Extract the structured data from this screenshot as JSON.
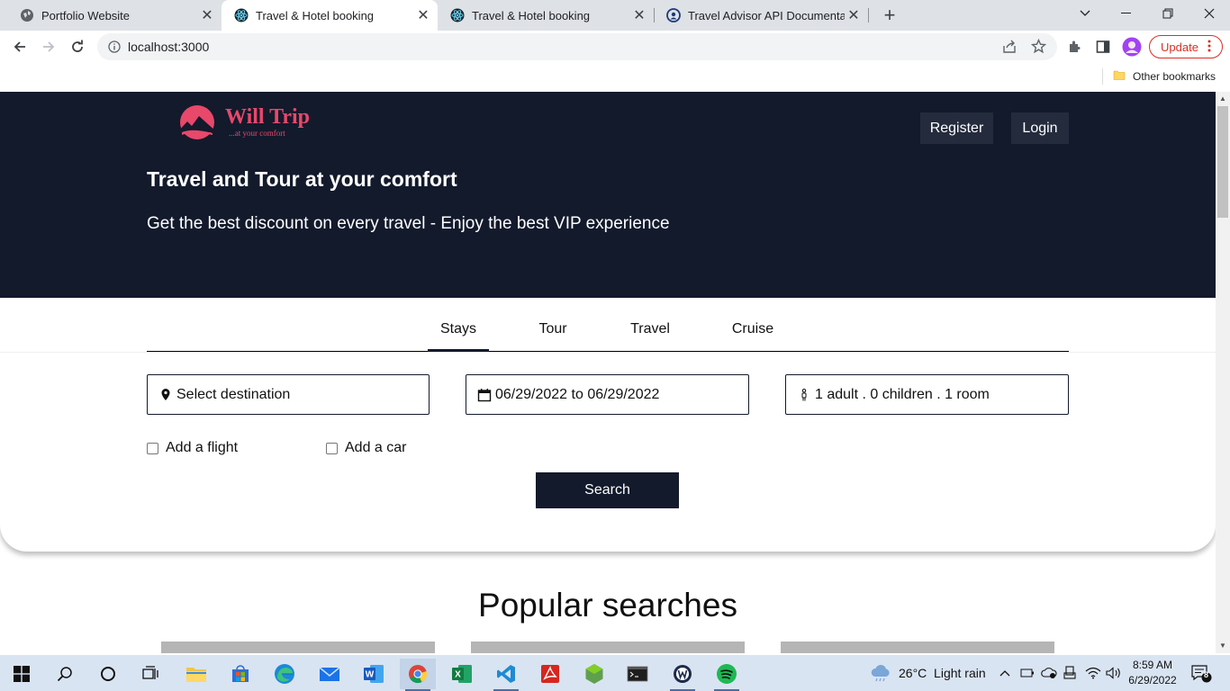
{
  "browser": {
    "tabs": [
      {
        "label": "Portfolio Website",
        "icon": "globe-icon",
        "active": false
      },
      {
        "label": "Travel & Hotel booking",
        "icon": "react-icon",
        "active": true
      },
      {
        "label": "Travel & Hotel booking",
        "icon": "react-icon",
        "active": false
      },
      {
        "label": "Travel Advisor API Documentation",
        "icon": "api-icon",
        "active": false
      }
    ],
    "url": "localhost:3000",
    "update_label": "Update",
    "bookmarks": {
      "other_label": "Other bookmarks"
    }
  },
  "page": {
    "logo": {
      "name": "Will Trip",
      "tagline": "...at your comfort"
    },
    "header_buttons": {
      "register": "Register",
      "login": "Login"
    },
    "hero": {
      "title": "Travel and Tour at your comfort",
      "subtitle": "Get the best discount on every travel - Enjoy the best VIP experience"
    },
    "tabs": [
      "Stays",
      "Tour",
      "Travel",
      "Cruise"
    ],
    "active_tab": "Stays",
    "search": {
      "destination_placeholder": "Select destination",
      "dates": "06/29/2022 to 06/29/2022",
      "guests": "1 adult . 0 children . 1 room",
      "add_flight": "Add a flight",
      "add_car": "Add a car",
      "button": "Search"
    },
    "popular_title": "Popular searches"
  },
  "taskbar": {
    "weather": "26°C  Light rain",
    "time": "8:59 AM",
    "date": "6/29/2022",
    "notifications": "8"
  },
  "colors": {
    "navy": "#131a2c",
    "brand_pink": "#e8486a"
  }
}
